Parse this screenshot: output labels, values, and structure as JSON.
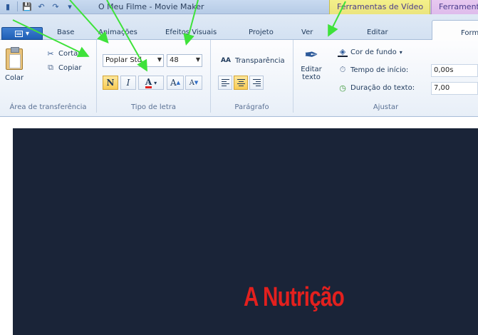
{
  "window": {
    "title": "O Meu Filme - Movie Maker",
    "contextual_tabs": [
      "Ferramentas de Vídeo",
      "Ferramentas"
    ]
  },
  "quick_access": {
    "icons": [
      "save-icon",
      "undo-icon",
      "redo-icon",
      "customize-icon"
    ]
  },
  "tabs": [
    "Base",
    "Animações",
    "Efeitos Visuais",
    "Projeto",
    "Ver",
    "Editar",
    "Formatar"
  ],
  "active_tab": "Formatar",
  "clipboard": {
    "group_label": "Área de transferência",
    "paste_label": "Colar",
    "cut_label": "Cortar",
    "copy_label": "Copiar"
  },
  "font": {
    "group_label": "Tipo de letra",
    "family_value": "Poplar Std",
    "size_value": "48",
    "bold_label": "N",
    "italic_label": "I",
    "color_label": "A",
    "grow_label": "A",
    "shrink_label": "A",
    "text_color": "#e3201e"
  },
  "paragraph": {
    "group_label": "Parágrafo",
    "transparency_label": "Transparência",
    "alignment_selected": "center"
  },
  "adjust": {
    "group_label": "Ajustar",
    "edit_text_label": "Editar texto",
    "background_color_label": "Cor de fundo",
    "start_time_label": "Tempo de início:",
    "start_time_value": "0,00s",
    "duration_label": "Duração do texto:",
    "duration_value": "7,00"
  },
  "preview": {
    "caption": "A Nutrição",
    "background": "#1a2438"
  },
  "annotations": {
    "arrow_color": "#3ee23a",
    "count": 5
  }
}
